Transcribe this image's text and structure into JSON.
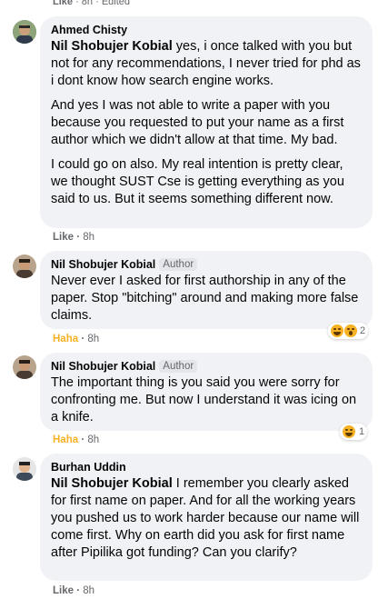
{
  "top_meta": {
    "action": "Like",
    "time": "8h",
    "edited": "Edited"
  },
  "comments": [
    {
      "author": "Ahmed Chisty",
      "mention": "Nil Shobujer Kobial",
      "paragraphs": [
        "Nil Shobujer Kobial yes, i once talked with you but not for any recommendations, I never tried for phd as i dont know how search engine works.",
        "And yes I was not able to write a paper with you because you requested to put your name as a first author which we didn't allow at that time. My bad.",
        "I could go on also. My real intention is pretty clear, we thought SUST Cse is getting everything as you said to us. But it seems something different now."
      ],
      "action": "Like",
      "time": "8h"
    },
    {
      "author": "Nil Shobujer Kobial",
      "badge": "Author",
      "text": "Never ever I asked for first authorship in any of the paper. Stop \"bitching\" around and making more false claims.",
      "action": "Haha",
      "time": "8h",
      "reactions_count": "2"
    },
    {
      "author": "Nil Shobujer Kobial",
      "badge": "Author",
      "text": "The important thing is you said you were sorry for confronting me. But now I understand it was icing on a knife.",
      "action": "Haha",
      "time": "8h",
      "reactions_count": "1"
    },
    {
      "author": "Burhan Uddin",
      "mention": "Nil Shobujer Kobial",
      "text_rest": "I remember you clearly asked for first name on paper. And for all the working years you pushed us to work harder because our name will come first. Why on earth did you ask for first name after Pipilika got funding? Can you clarify?",
      "action": "Like",
      "time": "8h"
    }
  ],
  "colors": {
    "bubble": "#f0f2f5",
    "meta": "#65676b",
    "haha": "#f7b125"
  },
  "icons": [
    "haha-icon",
    "wow-icon"
  ]
}
